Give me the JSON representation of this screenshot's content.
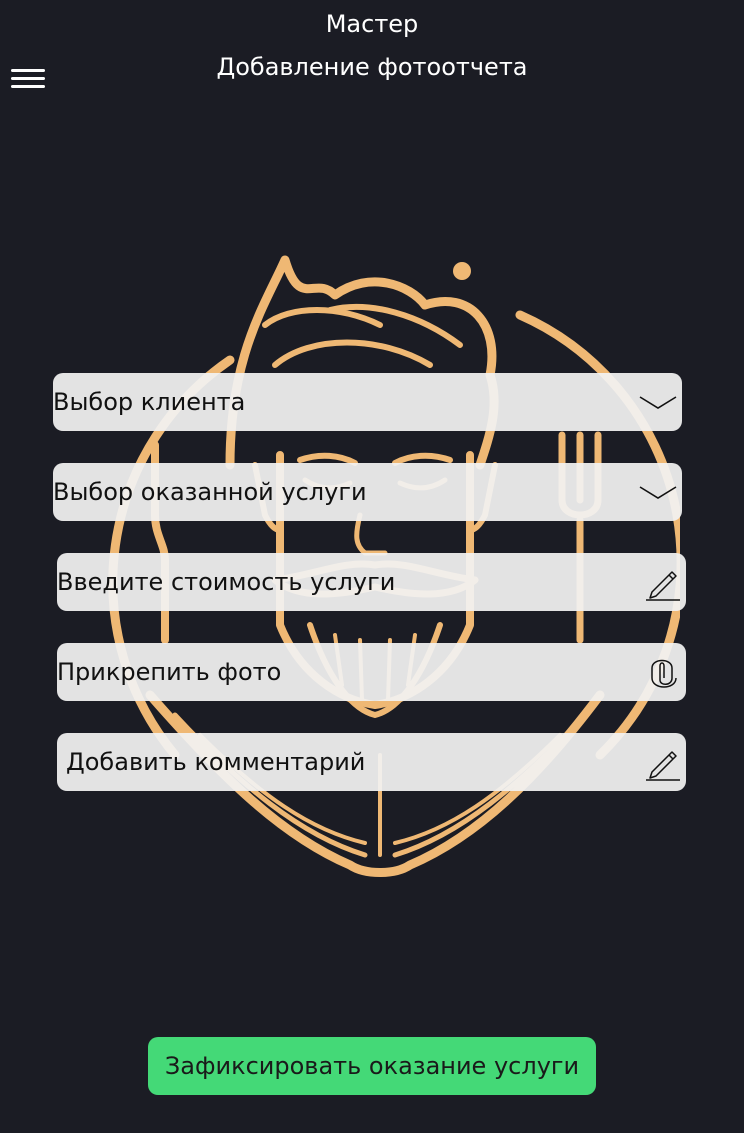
{
  "header": {
    "role": "Мастер",
    "title": "Добавление фотоотчета"
  },
  "form": {
    "client_select": {
      "label": "Выбор клиента",
      "icon": "chevron-down-icon"
    },
    "service_select": {
      "label": "Выбор оказанной услуги",
      "icon": "chevron-down-icon"
    },
    "price_input": {
      "placeholder": "Введите стоимость услуги",
      "icon": "pencil-icon"
    },
    "attach_photo": {
      "label": "Прикрепить фото",
      "icon": "paperclip-icon"
    },
    "comment_input": {
      "placeholder": "Добавить комментарий",
      "icon": "pencil-icon"
    }
  },
  "submit": {
    "label": "Зафиксировать оказание услуги"
  },
  "colors": {
    "background": "#1b1c24",
    "logo": "#efb874",
    "submit": "#44d977",
    "field": "#f2f2f2"
  }
}
